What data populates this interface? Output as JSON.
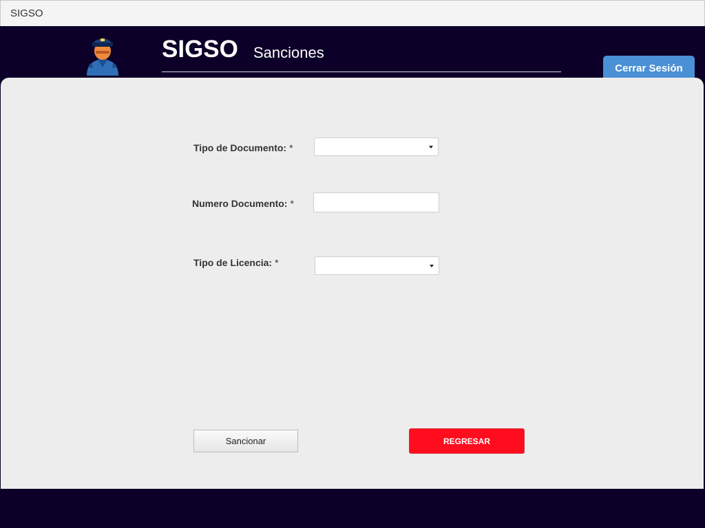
{
  "window": {
    "title": "SIGSO"
  },
  "header": {
    "app_name": "SIGSO",
    "section": "Sanciones",
    "logout_label": "Cerrar Sesión",
    "avatar_icon": "police-officer-icon"
  },
  "form": {
    "tipo_documento": {
      "label": "Tipo de Documento:",
      "required": "*",
      "value": ""
    },
    "numero_documento": {
      "label": "Numero Documento:",
      "required": "*",
      "value": "",
      "placeholder": ""
    },
    "tipo_licencia": {
      "label": "Tipo de Licencia:",
      "required": "*",
      "value": ""
    }
  },
  "actions": {
    "sancionar_label": "Sancionar",
    "regresar_label": "REGRESAR"
  },
  "colors": {
    "header_bg": "#0c0028",
    "logout_bg": "#4a90d4",
    "regresar_bg": "#ff0c1e",
    "panel_bg": "#ededed"
  }
}
